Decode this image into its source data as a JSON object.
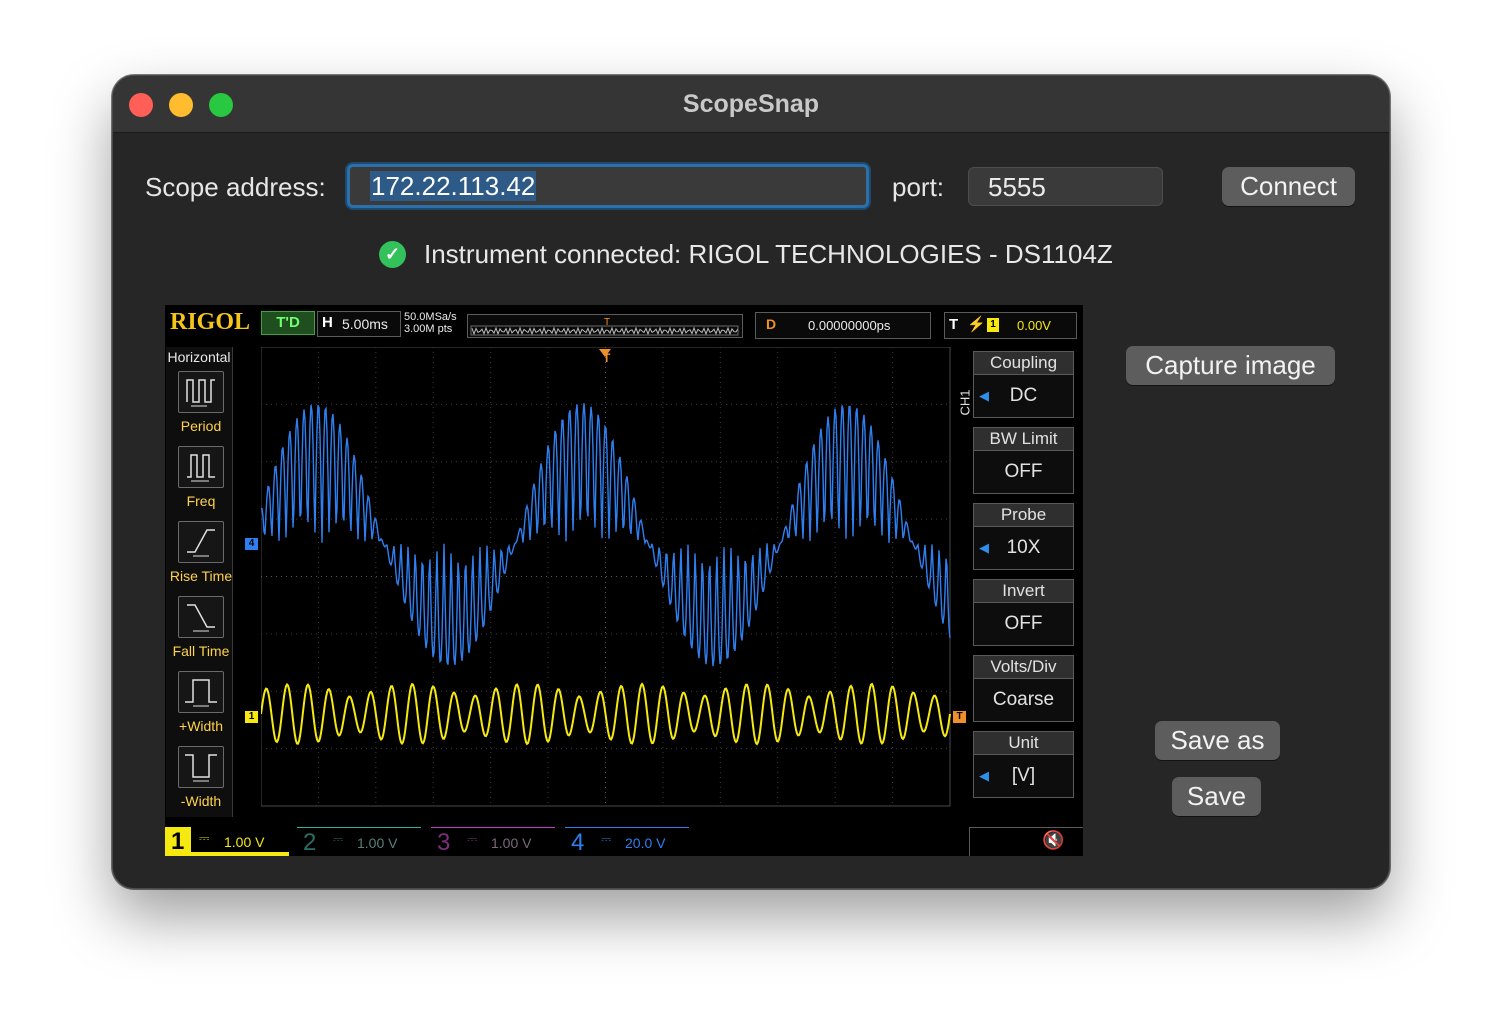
{
  "window": {
    "title": "ScopeSnap"
  },
  "connection": {
    "address_label": "Scope address:",
    "address_value": "172.22.113.42",
    "port_label": "port:",
    "port_value": "5555",
    "connect_label": "Connect",
    "status_text": "Instrument connected: RIGOL TECHNOLOGIES - DS1104Z"
  },
  "actions": {
    "capture_label": "Capture image",
    "save_as_label": "Save as",
    "save_label": "Save"
  },
  "scope": {
    "brand": "RIGOL",
    "run_state": "T'D",
    "h_label": "H",
    "timebase": "5.00ms",
    "sample_rate": "50.0MSa/s",
    "memory": "3.00M pts",
    "delay_label": "D",
    "delay_value": "0.00000000ps",
    "trigger_label": "T",
    "trigger_level": "0.00V",
    "left_menu": {
      "title": "Horizontal",
      "items": [
        "Period",
        "Freq",
        "Rise Time",
        "Fall Time",
        "+Width",
        "-Width"
      ]
    },
    "right_menu": {
      "channel_tag": "CH1",
      "items": [
        {
          "title": "Coupling",
          "value": "DC"
        },
        {
          "title": "BW Limit",
          "value": "OFF"
        },
        {
          "title": "Probe",
          "value": "10X"
        },
        {
          "title": "Invert",
          "value": "OFF"
        },
        {
          "title": "Volts/Div",
          "value": "Coarse"
        },
        {
          "title": "Unit",
          "value": "[V]"
        }
      ]
    },
    "channels": [
      {
        "num": "1",
        "scale": "1.00 V",
        "color": "#f5e90f"
      },
      {
        "num": "2",
        "scale": "1.00 V",
        "color": "#2fb0a0"
      },
      {
        "num": "3",
        "scale": "1.00 V",
        "color": "#c03cc0"
      },
      {
        "num": "4",
        "scale": "20.0 V",
        "color": "#2f7ff0"
      }
    ],
    "markers": {
      "ch4": "4",
      "ch1": "1",
      "trigger": "T"
    }
  },
  "colors": {
    "accent": "#2d6fa8",
    "status_ok": "#32c15a",
    "rigol_yellow": "#ffd24a",
    "ch1": "#f5e90f",
    "ch4": "#2f7ff0"
  },
  "icons": {
    "status": "check-circle-icon",
    "mute": "speaker-muted-icon"
  }
}
